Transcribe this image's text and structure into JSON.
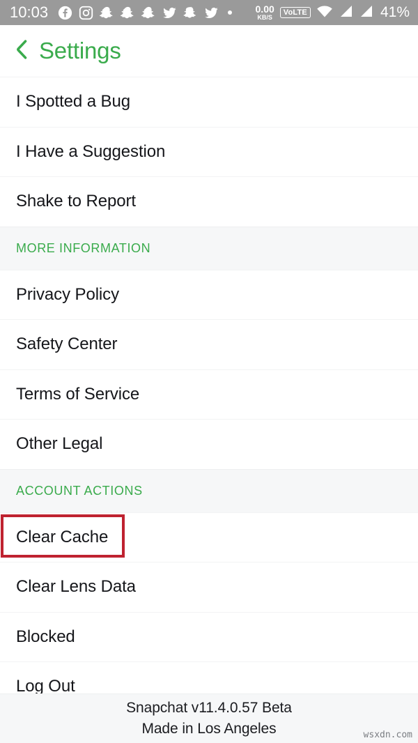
{
  "statusbar": {
    "clock": "10:03",
    "app_icons": [
      {
        "name": "facebook-icon"
      },
      {
        "name": "instagram-icon"
      },
      {
        "name": "snapchat-ghost-icon"
      },
      {
        "name": "snapchat-ghost-icon"
      },
      {
        "name": "snapchat-ghost-icon"
      },
      {
        "name": "twitter-icon"
      },
      {
        "name": "snapchat-logo-icon"
      },
      {
        "name": "twitter-icon"
      }
    ],
    "notification_dot": true,
    "net_speed_value": "0.00",
    "net_speed_unit": "KB/S",
    "volte_badge": "VoLTE",
    "wifi_icon": "wifi-icon",
    "signal_icons": [
      "signal-bars-icon",
      "signal-bars-icon"
    ],
    "battery_percent": "41%",
    "background_color": "#9a9a9a"
  },
  "header": {
    "back_icon": "chevron-left-icon",
    "title": "Settings",
    "accent_color": "#3aab4c"
  },
  "sections": [
    {
      "type": "rows",
      "items": [
        {
          "label": "I Spotted a Bug",
          "highlighted": false
        },
        {
          "label": "I Have a Suggestion",
          "highlighted": false
        },
        {
          "label": "Shake to Report",
          "highlighted": false
        }
      ]
    },
    {
      "type": "header",
      "label": "MORE INFORMATION"
    },
    {
      "type": "rows",
      "items": [
        {
          "label": "Privacy Policy",
          "highlighted": false
        },
        {
          "label": "Safety Center",
          "highlighted": false
        },
        {
          "label": "Terms of Service",
          "highlighted": false
        },
        {
          "label": "Other Legal",
          "highlighted": false
        }
      ]
    },
    {
      "type": "header",
      "label": "ACCOUNT ACTIONS"
    },
    {
      "type": "rows",
      "items": [
        {
          "label": "Clear Cache",
          "highlighted": true
        },
        {
          "label": "Clear Lens Data",
          "highlighted": false
        },
        {
          "label": "Blocked",
          "highlighted": false
        },
        {
          "label": "Log Out",
          "highlighted": false
        }
      ]
    }
  ],
  "footer": {
    "version_line": "Snapchat v11.4.0.57 Beta",
    "location_line": "Made in Los Angeles"
  },
  "watermark": {
    "text": "wsxdn.com"
  },
  "colors": {
    "accent_green": "#3aab4c",
    "highlight_red": "#bf2230",
    "section_bg": "#f6f7f8",
    "text": "#15161a"
  }
}
